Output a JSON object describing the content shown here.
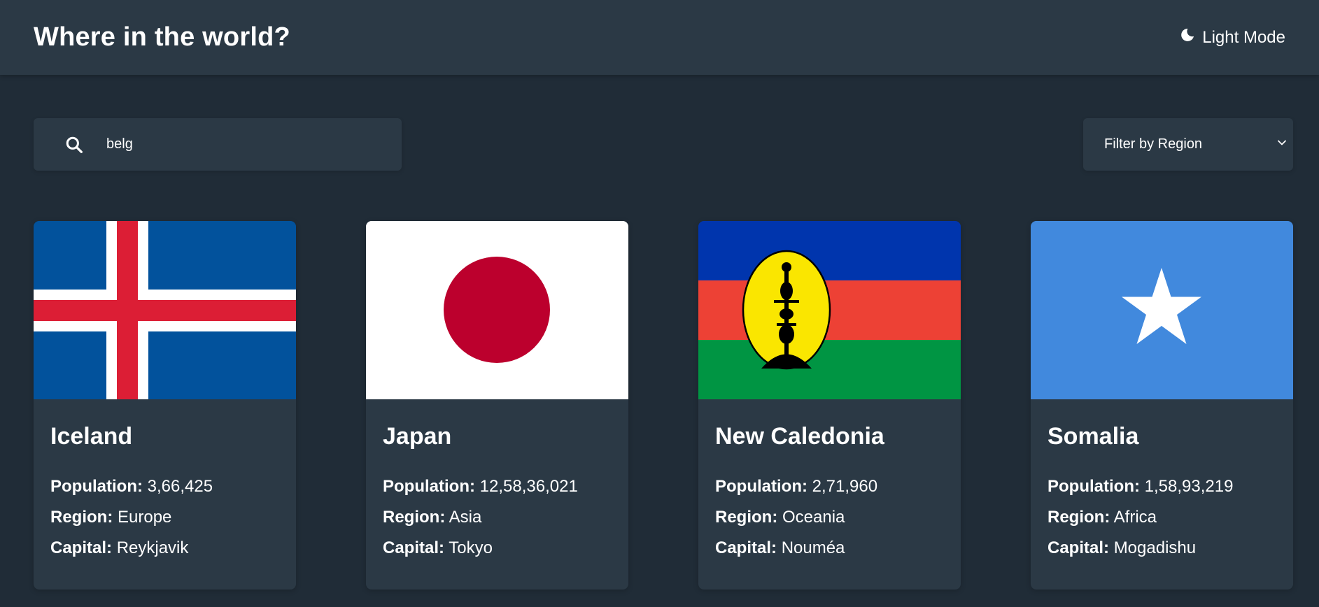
{
  "header": {
    "title": "Where in the world?",
    "mode_label": "Light Mode",
    "mode_icon": "moon-icon"
  },
  "search": {
    "value": "belg",
    "icon": "search-icon"
  },
  "filter": {
    "label": "Filter by Region",
    "icon": "chevron-down-icon"
  },
  "labels": {
    "population": "Population:",
    "region": "Region:",
    "capital": "Capital:"
  },
  "countries": [
    {
      "name": "Iceland",
      "population": "3,66,425",
      "region": "Europe",
      "capital": "Reykjavik",
      "flag": "iceland-flag"
    },
    {
      "name": "Japan",
      "population": "12,58,36,021",
      "region": "Asia",
      "capital": "Tokyo",
      "flag": "japan-flag"
    },
    {
      "name": "New Caledonia",
      "population": "2,71,960",
      "region": "Oceania",
      "capital": "Nouméa",
      "flag": "new-caledonia-flag"
    },
    {
      "name": "Somalia",
      "population": "1,58,93,219",
      "region": "Africa",
      "capital": "Mogadishu",
      "flag": "somalia-flag"
    }
  ],
  "colors": {
    "background": "#202c37",
    "surface": "#2b3945",
    "text": "#ffffff"
  }
}
